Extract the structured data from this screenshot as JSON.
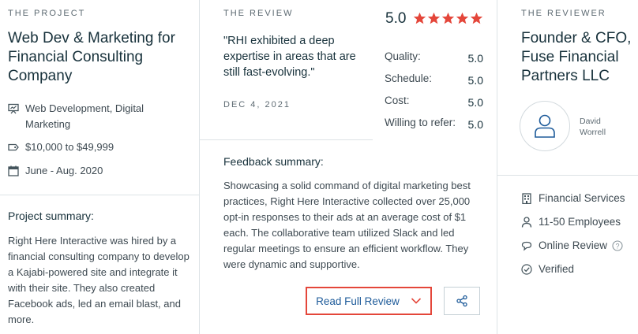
{
  "project": {
    "label": "THE PROJECT",
    "title": "Web Dev & Marketing for Financial Consulting Company",
    "service": "Web Development, Digital Marketing",
    "budget": "$10,000 to $49,999",
    "dates": "June - Aug. 2020",
    "summary_label": "Project summary:",
    "summary": "Right Here Interactive was hired by a financial consulting company to develop a Kajabi-powered site and integrate it with their site. They also created Facebook ads, led an email blast, and more."
  },
  "review": {
    "label": "THE REVIEW",
    "quote": "\"RHI exhibited a deep expertise in areas that are still fast-evolving.\"",
    "date": "DEC 4, 2021",
    "overall": "5.0",
    "stars": 5,
    "star_color": "#e4463a",
    "ratings": [
      {
        "label": "Quality:",
        "value": "5.0"
      },
      {
        "label": "Schedule:",
        "value": "5.0"
      },
      {
        "label": "Cost:",
        "value": "5.0"
      },
      {
        "label": "Willing to refer:",
        "value": "5.0"
      }
    ],
    "feedback_label": "Feedback summary:",
    "feedback": "Showcasing a solid command of digital marketing best practices, Right Here Interactive collected over 25,000 opt-in responses to their ads at an average cost of $1 each. The collaborative team utilized Slack and led regular meetings to ensure an efficient workflow. They were dynamic and supportive.",
    "read_full_label": "Read Full Review",
    "accent_color": "#1e5b9a"
  },
  "reviewer": {
    "label": "THE REVIEWER",
    "title_lines": [
      "Founder & CFO,",
      "Fuse Financial",
      "Partners LLC"
    ],
    "name": "David Worrell",
    "industry": "Financial Services",
    "size": "11-50 Employees",
    "review_type": "Online Review",
    "status": "Verified"
  }
}
